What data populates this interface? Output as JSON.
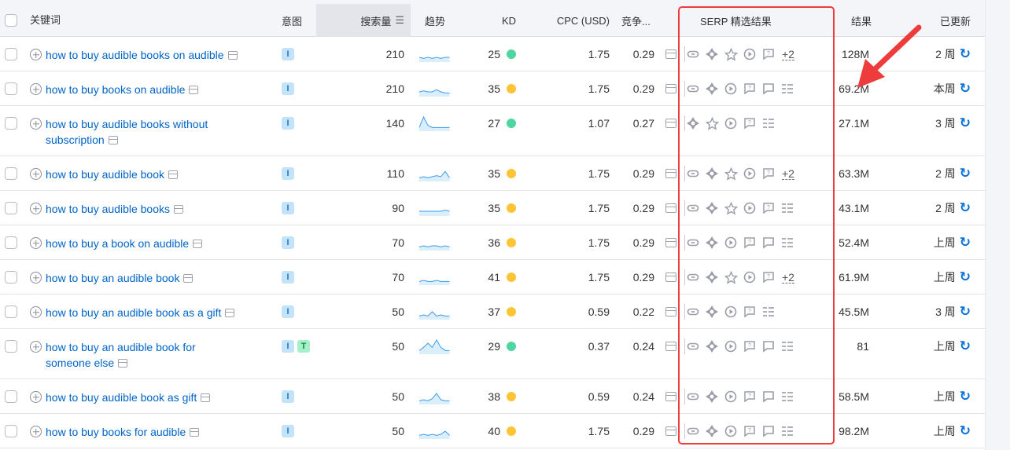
{
  "header": {
    "keyword": "关键词",
    "intent": "意图",
    "volume": "搜索量",
    "trend": "趋势",
    "kd": "KD",
    "cpc": "CPC (USD)",
    "competition": "竞争...",
    "serp": "SERP 精选结果",
    "results": "结果",
    "updated": "已更新"
  },
  "colors": {
    "green": "#4fd6a0",
    "yellow": "#ffc435",
    "link": "#0064c8",
    "annotation": "#ee3b3b"
  },
  "rows": [
    {
      "keyword": "how to buy audible books on audible",
      "intents": [
        "I"
      ],
      "volume": "210",
      "trend": [
        3,
        2,
        3,
        2,
        3,
        2,
        3,
        3
      ],
      "kd": "25",
      "kd_color": "green",
      "cpc": "1.75",
      "comp": "0.29",
      "features": [
        "link",
        "diamond",
        "star",
        "play",
        "qa"
      ],
      "more": "+2",
      "results": "128M",
      "updated": "2 周"
    },
    {
      "keyword": "how to buy books on audible",
      "intents": [
        "I"
      ],
      "volume": "210",
      "trend": [
        3,
        4,
        3,
        3,
        5,
        3,
        2,
        2
      ],
      "kd": "35",
      "kd_color": "yellow",
      "cpc": "1.75",
      "comp": "0.29",
      "features": [
        "link",
        "diamond",
        "play",
        "qa",
        "comment",
        "list"
      ],
      "results": "69.2M",
      "updated": "本周"
    },
    {
      "keyword": "how to buy audible books without subscription",
      "intents": [
        "I"
      ],
      "volume": "140",
      "trend": [
        2,
        12,
        4,
        2,
        2,
        2,
        2,
        2
      ],
      "kd": "27",
      "kd_color": "green",
      "cpc": "1.07",
      "comp": "0.27",
      "features": [
        "diamond",
        "star",
        "play",
        "qa",
        "list"
      ],
      "results": "27.1M",
      "updated": "3 周"
    },
    {
      "keyword": "how to buy audible book",
      "intents": [
        "I"
      ],
      "volume": "110",
      "trend": [
        2,
        3,
        2,
        3,
        4,
        3,
        8,
        2
      ],
      "kd": "35",
      "kd_color": "yellow",
      "cpc": "1.75",
      "comp": "0.29",
      "features": [
        "link",
        "diamond",
        "star",
        "play",
        "qa"
      ],
      "more": "+2",
      "results": "63.3M",
      "updated": "2 周"
    },
    {
      "keyword": "how to buy audible books",
      "intents": [
        "I"
      ],
      "volume": "90",
      "trend": [
        3,
        3,
        3,
        3,
        3,
        3,
        4,
        3
      ],
      "kd": "35",
      "kd_color": "yellow",
      "cpc": "1.75",
      "comp": "0.29",
      "features": [
        "link",
        "diamond",
        "star",
        "play",
        "qa",
        "list"
      ],
      "results": "43.1M",
      "updated": "2 周"
    },
    {
      "keyword": "how to buy a book on audible",
      "intents": [
        "I"
      ],
      "volume": "70",
      "trend": [
        2,
        3,
        2,
        3,
        3,
        2,
        3,
        2
      ],
      "kd": "36",
      "kd_color": "yellow",
      "cpc": "1.75",
      "comp": "0.29",
      "features": [
        "link",
        "diamond",
        "play",
        "qa",
        "comment",
        "list"
      ],
      "results": "52.4M",
      "updated": "上周"
    },
    {
      "keyword": "how to buy an audible book",
      "intents": [
        "I"
      ],
      "volume": "70",
      "trend": [
        2,
        3,
        2,
        2,
        3,
        2,
        2,
        2
      ],
      "kd": "41",
      "kd_color": "yellow",
      "cpc": "1.75",
      "comp": "0.29",
      "features": [
        "link",
        "diamond",
        "star",
        "play",
        "qa"
      ],
      "more": "+2",
      "results": "61.9M",
      "updated": "上周"
    },
    {
      "keyword": "how to buy an audible book as a gift",
      "intents": [
        "I"
      ],
      "volume": "50",
      "trend": [
        2,
        3,
        2,
        6,
        2,
        3,
        2,
        2
      ],
      "kd": "37",
      "kd_color": "yellow",
      "cpc": "0.59",
      "comp": "0.22",
      "features": [
        "link",
        "diamond",
        "play",
        "qa",
        "list"
      ],
      "results": "45.5M",
      "updated": "3 周"
    },
    {
      "keyword": "how to buy an audible book for someone else",
      "intents": [
        "I",
        "T"
      ],
      "volume": "50",
      "trend": [
        2,
        5,
        9,
        5,
        12,
        5,
        2,
        2
      ],
      "kd": "29",
      "kd_color": "green",
      "cpc": "0.37",
      "comp": "0.24",
      "features": [
        "link",
        "diamond",
        "play",
        "qa",
        "comment",
        "list"
      ],
      "results": "81",
      "updated": "上周"
    },
    {
      "keyword": "how to buy audible book as gift",
      "intents": [
        "I"
      ],
      "volume": "50",
      "trend": [
        2,
        3,
        2,
        4,
        9,
        3,
        2,
        2
      ],
      "kd": "38",
      "kd_color": "yellow",
      "cpc": "0.59",
      "comp": "0.24",
      "features": [
        "link",
        "diamond",
        "play",
        "qa",
        "comment",
        "list"
      ],
      "results": "58.5M",
      "updated": "上周"
    },
    {
      "keyword": "how to buy books for audible",
      "intents": [
        "I"
      ],
      "volume": "50",
      "trend": [
        2,
        3,
        2,
        3,
        2,
        3,
        6,
        2
      ],
      "kd": "40",
      "kd_color": "yellow",
      "cpc": "1.75",
      "comp": "0.29",
      "features": [
        "link",
        "diamond",
        "play",
        "qa",
        "comment",
        "list"
      ],
      "results": "98.2M",
      "updated": "上周"
    }
  ]
}
